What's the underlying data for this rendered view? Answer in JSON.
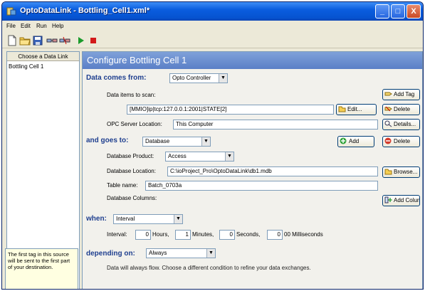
{
  "window": {
    "title": "OptoDataLink - Bottling_Cell1.xml*",
    "controls": {
      "minimize": "_",
      "maximize": "□",
      "close": "X"
    }
  },
  "menu": [
    "File",
    "Edit",
    "Run",
    "Help"
  ],
  "toolbar": {
    "icons": [
      "new-file-icon",
      "open-folder-icon",
      "save-icon",
      "link-icon",
      "unlink-icon",
      "run-icon",
      "stop-icon"
    ]
  },
  "left": {
    "header": "Choose a Data Link",
    "items": [
      "Bottling Cell 1"
    ],
    "tip": "The first tag in this source will be sent to the first part of your destination."
  },
  "main": {
    "title": "Configure Bottling Cell 1",
    "data_from": {
      "label": "Data comes from:",
      "value": "Opto Controller",
      "items_label": "Data items to scan:",
      "add_tag": "Add Tag",
      "item_value": "[MMIO]ip|tcp:127.0.0.1:2001|STATE[2]",
      "edit": "Edit...",
      "delete": "Delete",
      "opc_label": "OPC Server Location:",
      "opc_value": "This Computer",
      "details": "Details..."
    },
    "goes_to": {
      "label": "and goes to:",
      "value": "Database",
      "add": "Add",
      "delete": "Delete",
      "product_label": "Database Product:",
      "product_value": "Access",
      "location_label": "Database Location:",
      "location_value": "C:\\ioProject_Pro\\OptoDataLink\\db1.mdb",
      "browse": "Browse...",
      "table_label": "Table name:",
      "table_value": "Batch_0703a",
      "columns_label": "Database Columns:",
      "add_column": "Add Column"
    },
    "when": {
      "label": "when:",
      "value": "Interval",
      "interval_label": "Interval:",
      "hours": "0",
      "hours_label": "Hours,",
      "minutes": "1",
      "minutes_label": "Minutes,",
      "seconds": "0",
      "seconds_label": "Seconds,",
      "ms": "0",
      "ms_label": "00 Milliseconds"
    },
    "depending": {
      "label": "depending on:",
      "value": "Always",
      "note": "Data will always flow. Choose a different condition to refine your data exchanges."
    }
  },
  "colors": {
    "title_bar": "#0a5ddf",
    "header_band": "#6a8fd0",
    "section_text": "#1f3f8f",
    "tip_bg": "#ffffe1"
  }
}
